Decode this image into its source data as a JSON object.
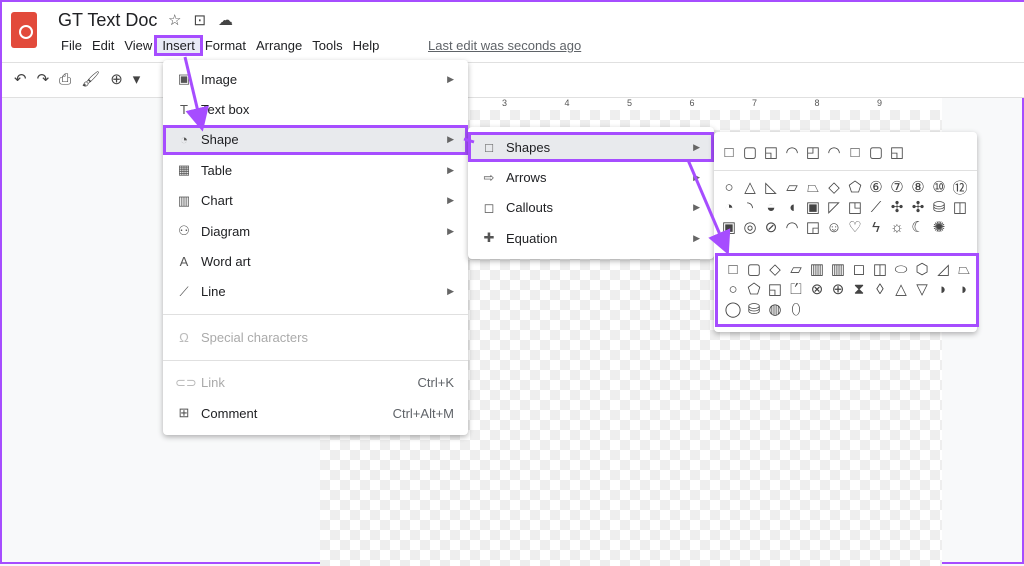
{
  "app": {
    "title": "GT Text Doc",
    "last_edit": "Last edit was seconds ago"
  },
  "menubar": [
    "File",
    "Edit",
    "View",
    "Insert",
    "Format",
    "Arrange",
    "Tools",
    "Help"
  ],
  "toolbar_icons": [
    "undo-icon",
    "redo-icon",
    "print-icon",
    "paint-format-icon",
    "zoom-icon"
  ],
  "ruler": [
    "3",
    "4",
    "5",
    "6",
    "7",
    "8",
    "9"
  ],
  "insert_menu": [
    {
      "label": "Image",
      "icon": "▣",
      "sub": true
    },
    {
      "label": "Text box",
      "icon": "T",
      "sub": false
    },
    {
      "label": "Shape",
      "icon": "◔",
      "sub": true
    },
    {
      "label": "Table",
      "icon": "▦",
      "sub": true
    },
    {
      "label": "Chart",
      "icon": "▥",
      "sub": true
    },
    {
      "label": "Diagram",
      "icon": "⚇",
      "sub": true
    },
    {
      "label": "Word art",
      "icon": "A",
      "sub": false
    },
    {
      "label": "Line",
      "icon": "⟋",
      "sub": true
    },
    {
      "label": "Special characters",
      "icon": "Ω",
      "disabled": true
    },
    {
      "label": "Link",
      "icon": "⊂⊃",
      "shortcut": "Ctrl+K",
      "disabled": true
    },
    {
      "label": "Comment",
      "icon": "⊞",
      "shortcut": "Ctrl+Alt+M"
    }
  ],
  "shape_menu": [
    {
      "label": "Shapes",
      "icon": "□"
    },
    {
      "label": "Arrows",
      "icon": "⇨"
    },
    {
      "label": "Callouts",
      "icon": "◻"
    },
    {
      "label": "Equation",
      "icon": "✚"
    }
  ],
  "palette": {
    "rectangles": "□▢◱◠◰◠□▢◱",
    "basic": [
      "○△◺▱⏢◇⬠⑥⑦⑧⑩⑫",
      "◔◝◒◖▣◸◳⟋✣✣⛁◫",
      "▣◎⊘◠◲☺♡ϟ☼☾✺"
    ],
    "flowchart": [
      "□▢◇▱▥▥◻◫⬭⬡◿⏢",
      "○⬠◱⏍⊗⊕⧗◊△▽◗◗",
      "◯⛁◍⬯"
    ]
  }
}
